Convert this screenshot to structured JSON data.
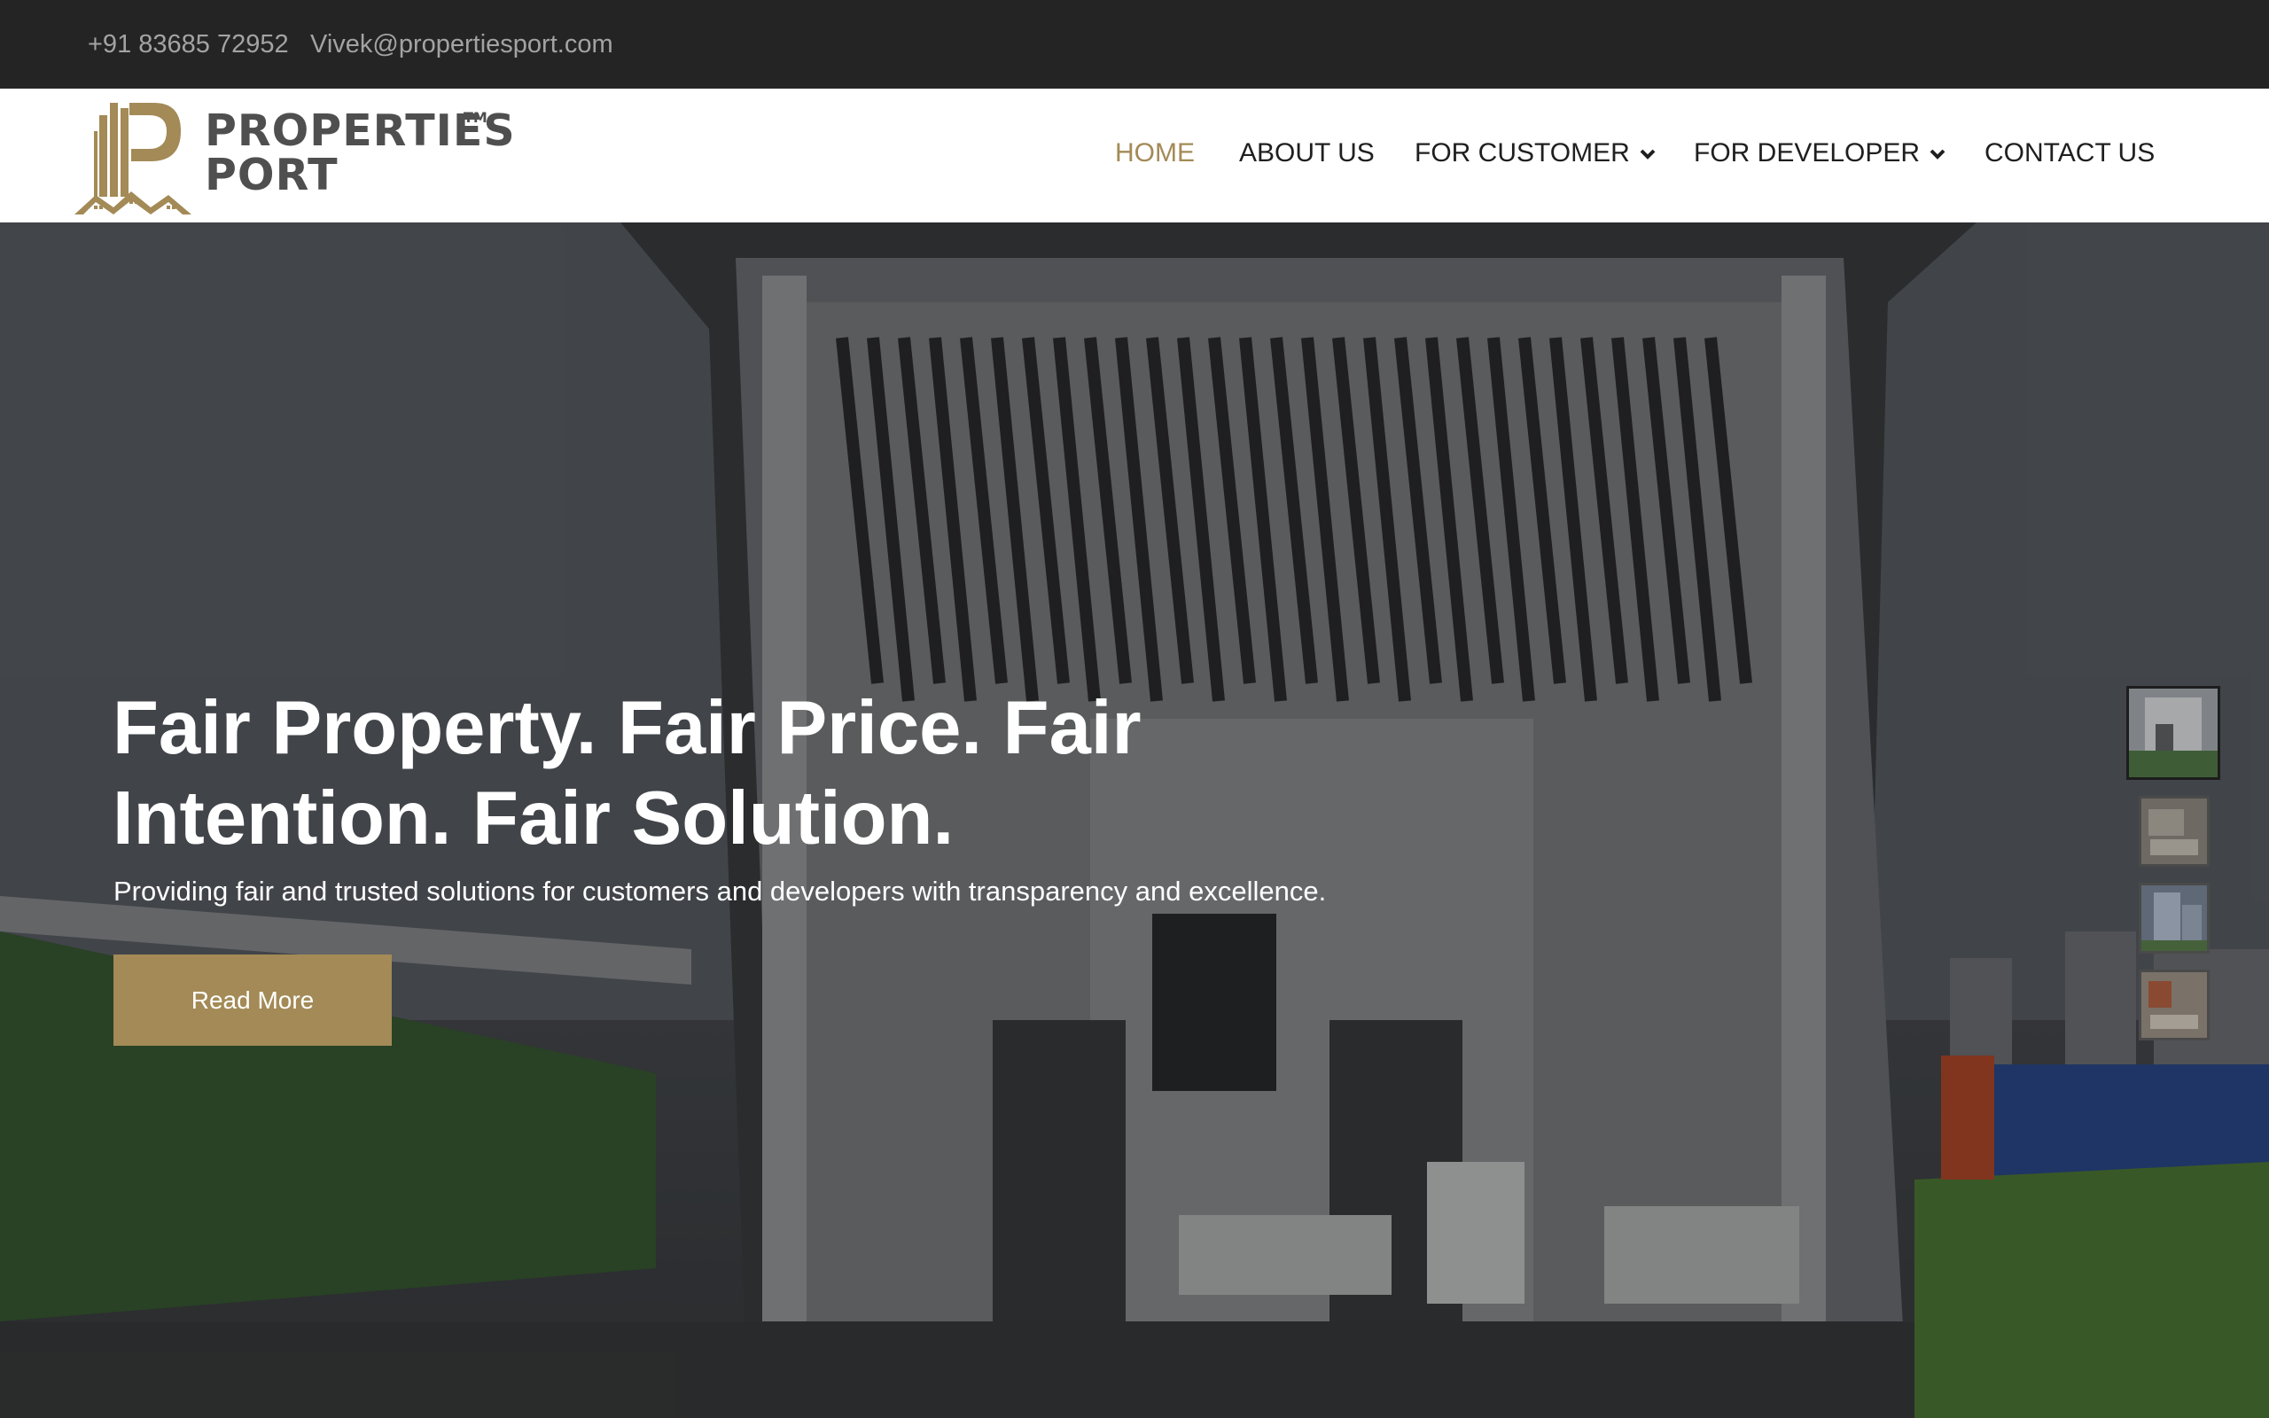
{
  "topbar": {
    "phone": "+91 83685 72952",
    "email": "Vivek@propertiesport.com"
  },
  "brand": {
    "line1": "PROPERTIES",
    "line2": "PORT",
    "tm": "TM",
    "logo_icon": "building-p-logo-icon",
    "color_gold": "#a38a56",
    "color_dark": "#4f4f4f"
  },
  "nav": {
    "items": [
      {
        "label": "HOME",
        "active": true
      },
      {
        "label": "ABOUT US",
        "active": false
      },
      {
        "label": "FOR CUSTOMER",
        "active": false,
        "icon": "chevron-down-icon"
      },
      {
        "label": "FOR DEVELOPER",
        "active": false,
        "icon": "chevron-down-icon"
      },
      {
        "label": "CONTACT US",
        "active": false
      }
    ]
  },
  "hero": {
    "title": "Fair Property. Fair Price. Fair Intention. Fair Solution.",
    "subtitle": "Providing fair and trusted solutions for customers and developers with transparency and excellence.",
    "cta_label": "Read More",
    "slides": [
      {
        "name": "glass-building-thumbnail",
        "active": true
      },
      {
        "name": "interior-room-thumbnail",
        "active": false
      },
      {
        "name": "apartment-tower-thumbnail",
        "active": false
      },
      {
        "name": "living-room-thumbnail",
        "active": false
      }
    ]
  }
}
